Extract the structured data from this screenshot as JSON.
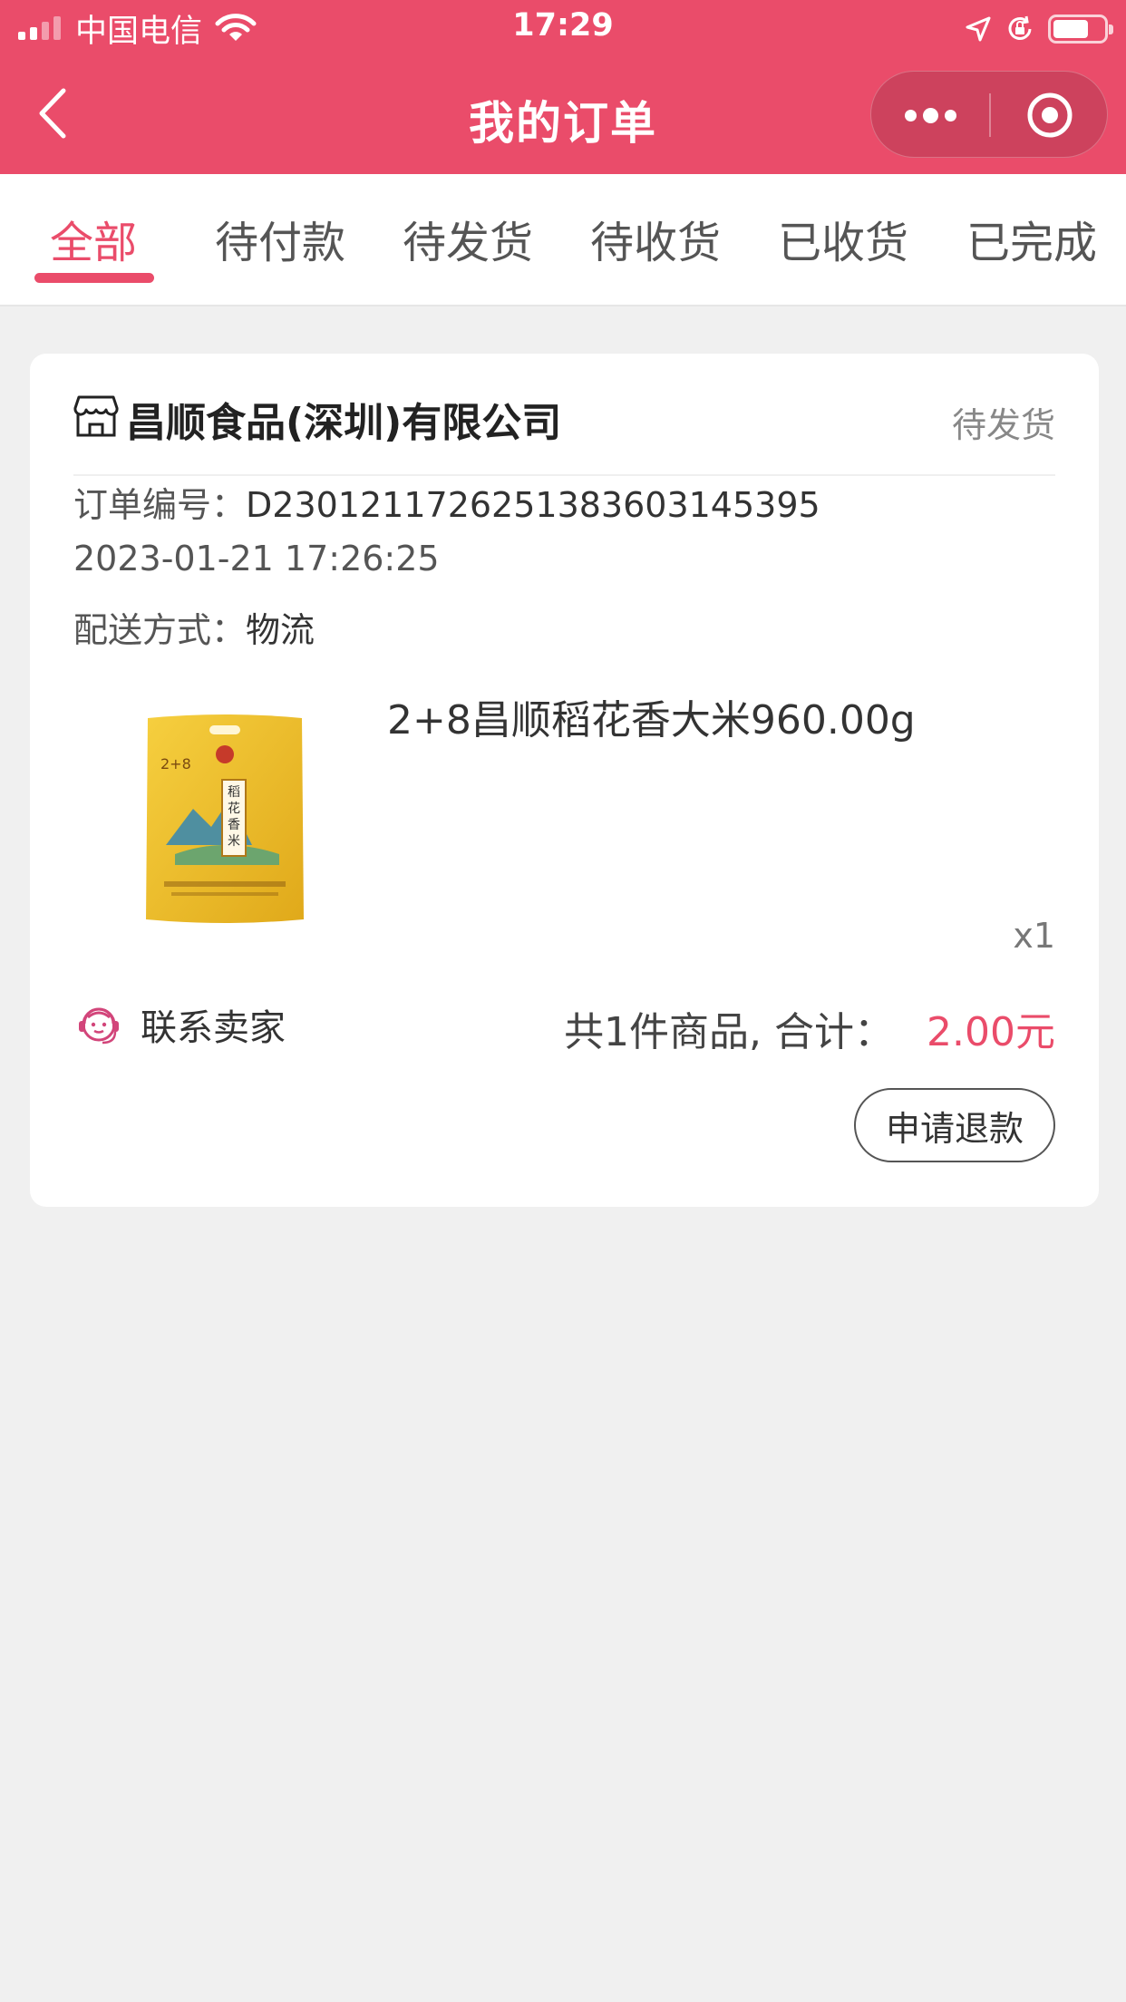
{
  "status_bar": {
    "carrier": "中国电信",
    "time": "17:29",
    "battery_level": 0.7
  },
  "nav": {
    "title": "我的订单"
  },
  "tabs": [
    {
      "label": "全部",
      "active": true
    },
    {
      "label": "待付款",
      "active": false
    },
    {
      "label": "待发货",
      "active": false
    },
    {
      "label": "待收货",
      "active": false
    },
    {
      "label": "已收货",
      "active": false
    },
    {
      "label": "已完成",
      "active": false
    }
  ],
  "order": {
    "shop_name": "昌顺食品(深圳)有限公司",
    "status": "待发货",
    "order_no_label": "订单编号：",
    "order_no": "D230121172625138360314​5395",
    "datetime": "2023-01-21 17:26:25",
    "delivery_label": "配送方式：",
    "delivery": "物流",
    "product": {
      "name": "2+8昌顺稻花香大米960.00g",
      "quantity": "x1",
      "package_text": "稻花香米",
      "brand_mark": "2+8"
    },
    "contact_label": "联系卖家",
    "summary_label": "共1件商品, 合计：",
    "total": "2.00元",
    "refund_button": "申请退款"
  },
  "colors": {
    "accent": "#ea4c6a",
    "background": "#f0f0f0"
  }
}
